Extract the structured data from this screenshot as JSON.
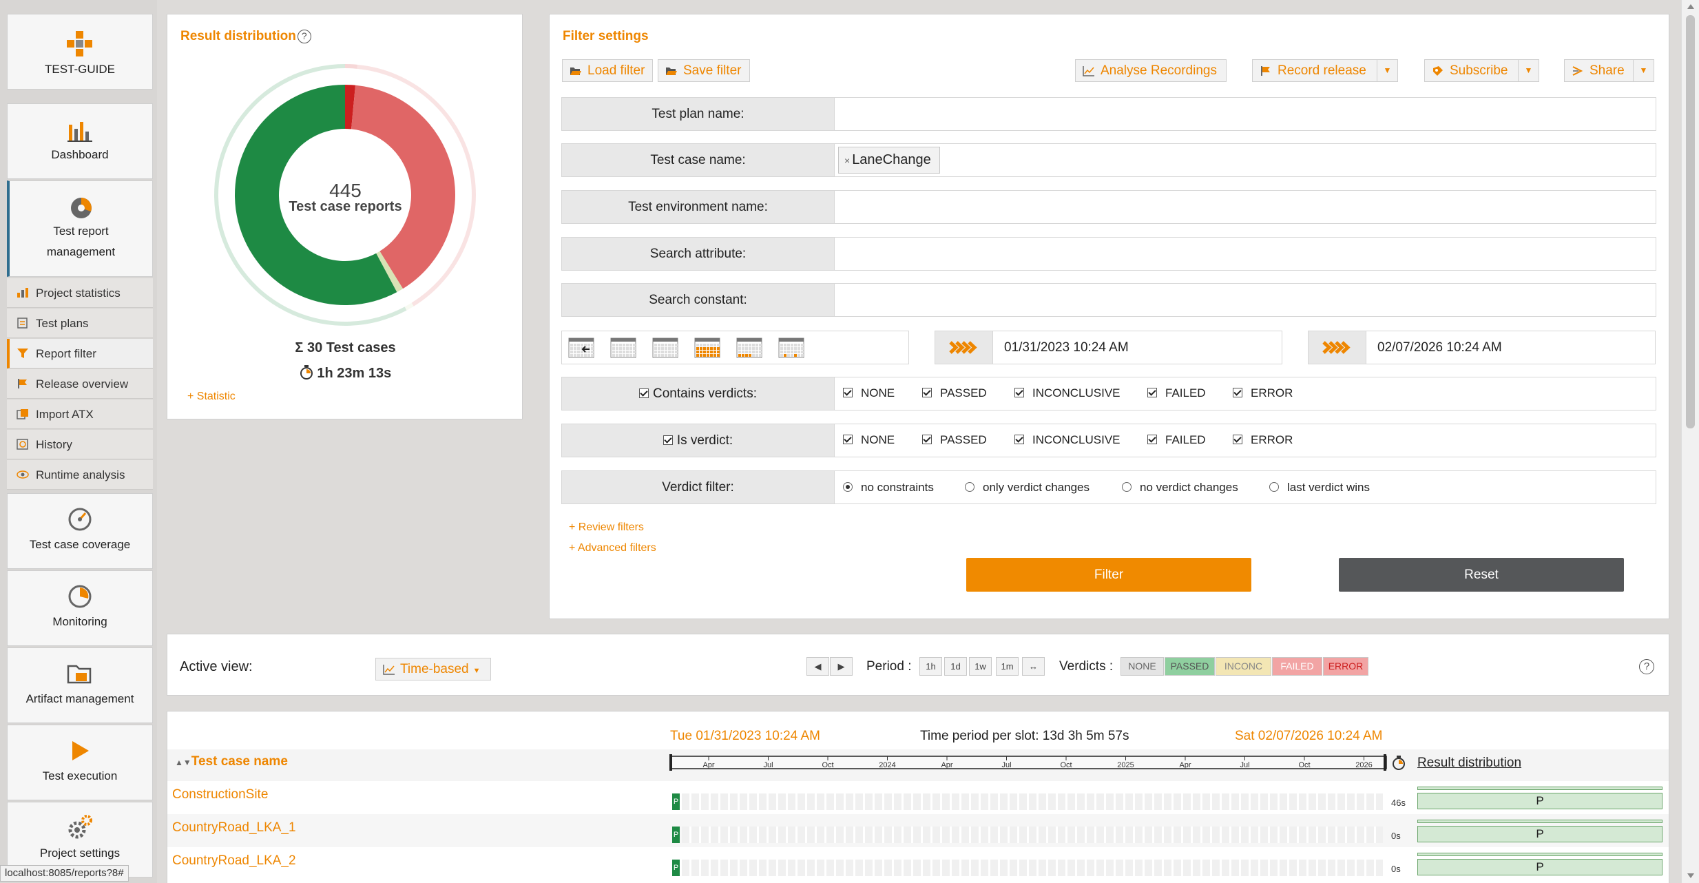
{
  "app": {
    "name": "TEST-GUIDE",
    "status_url": "localhost:8085/reports?8#"
  },
  "sidebar": {
    "main_items": [
      {
        "label": "Dashboard"
      },
      {
        "label": "Test report management"
      }
    ],
    "sub_items": [
      {
        "label": "Project statistics"
      },
      {
        "label": "Test plans"
      },
      {
        "label": "Report filter"
      },
      {
        "label": "Release overview"
      },
      {
        "label": "Import ATX"
      },
      {
        "label": "History"
      },
      {
        "label": "Runtime analysis"
      }
    ],
    "bottom_items": [
      {
        "label": "Test case coverage"
      },
      {
        "label": "Monitoring"
      },
      {
        "label": "Artifact management"
      },
      {
        "label": "Test execution"
      },
      {
        "label": "Project settings"
      }
    ]
  },
  "result_distribution": {
    "title": "Result distribution",
    "help": "?",
    "count": "445",
    "count_label": "Test case reports",
    "test_cases": "Σ 30 Test cases",
    "duration": "1h 23m 13s",
    "statistic_link": "+ Statistic",
    "slices": [
      {
        "verdict": "PASSED",
        "fraction": 0.578,
        "color": "#1e8a44"
      },
      {
        "verdict": "INCONCLUSIVE",
        "fraction": 0.01,
        "color": "#d9e3b5"
      },
      {
        "verdict": "FAILED",
        "fraction": 0.397,
        "color": "#e06666"
      },
      {
        "verdict": "ERROR",
        "fraction": 0.015,
        "color": "#cc1f1f"
      }
    ]
  },
  "filter": {
    "title": "Filter settings",
    "toolbar": {
      "load": "Load filter",
      "save": "Save filter",
      "analyse": "Analyse Recordings",
      "record": "Record release",
      "subscribe": "Subscribe",
      "share": "Share"
    },
    "fields": {
      "test_plan": "Test plan name:",
      "test_case": "Test case name:",
      "test_case_tag": "LaneChange",
      "test_env": "Test environment name:",
      "search_attr": "Search attribute:",
      "search_const": "Search constant:"
    },
    "date_from": "01/31/2023 10:24 AM",
    "date_to": "02/07/2026 10:24 AM",
    "contains_verdicts": {
      "label": "Contains verdicts:",
      "options": [
        "NONE",
        "PASSED",
        "INCONCLUSIVE",
        "FAILED",
        "ERROR"
      ]
    },
    "is_verdict": {
      "label": "Is verdict:",
      "options": [
        "NONE",
        "PASSED",
        "INCONCLUSIVE",
        "FAILED",
        "ERROR"
      ]
    },
    "verdict_filter": {
      "label": "Verdict filter:",
      "options": [
        "no constraints",
        "only verdict changes",
        "no verdict changes",
        "last verdict wins"
      ],
      "selected": "no constraints"
    },
    "review_link": "+ Review filters",
    "advanced_link": "+ Advanced filters",
    "filter_btn": "Filter",
    "reset_btn": "Reset"
  },
  "view": {
    "active_label": "Active view:",
    "active_value": "Time-based",
    "period_label": "Period :",
    "periods": [
      "1h",
      "1d",
      "1w",
      "1m",
      "↔"
    ],
    "verdicts_label": "Verdicts :",
    "verdicts": [
      {
        "label": "NONE",
        "bg": "#e4e4e4",
        "fg": "#666666"
      },
      {
        "label": "PASSED",
        "bg": "#8fcf9f",
        "fg": "#555555"
      },
      {
        "label": "INCONC",
        "bg": "#f3e6b4",
        "fg": "#888888"
      },
      {
        "label": "FAILED",
        "bg": "#f2a4a4",
        "fg": "#ffffff"
      },
      {
        "label": "ERROR",
        "bg": "#f2a4a4",
        "fg": "#cc1f1f"
      }
    ],
    "help": "?"
  },
  "timeline": {
    "start": "Tue 01/31/2023 10:24 AM",
    "slot": "Time period per slot: 13d 3h 5m 57s",
    "end": "Sat 02/07/2026 10:24 AM",
    "col_header": "Test case name",
    "result_header": "Result distribution",
    "ticks": [
      "Apr",
      "Jul",
      "Oct",
      "2024",
      "Apr",
      "Jul",
      "Oct",
      "2025",
      "Apr",
      "Jul",
      "Oct",
      "2026"
    ],
    "rows": [
      {
        "name": "ConstructionSite",
        "verdict": "P",
        "duration": "46s",
        "result": "P"
      },
      {
        "name": "CountryRoad_LKA_1",
        "verdict": "P",
        "duration": "0s",
        "result": "P"
      },
      {
        "name": "CountryRoad_LKA_2",
        "verdict": "P",
        "duration": "0s",
        "result": "P"
      }
    ]
  }
}
